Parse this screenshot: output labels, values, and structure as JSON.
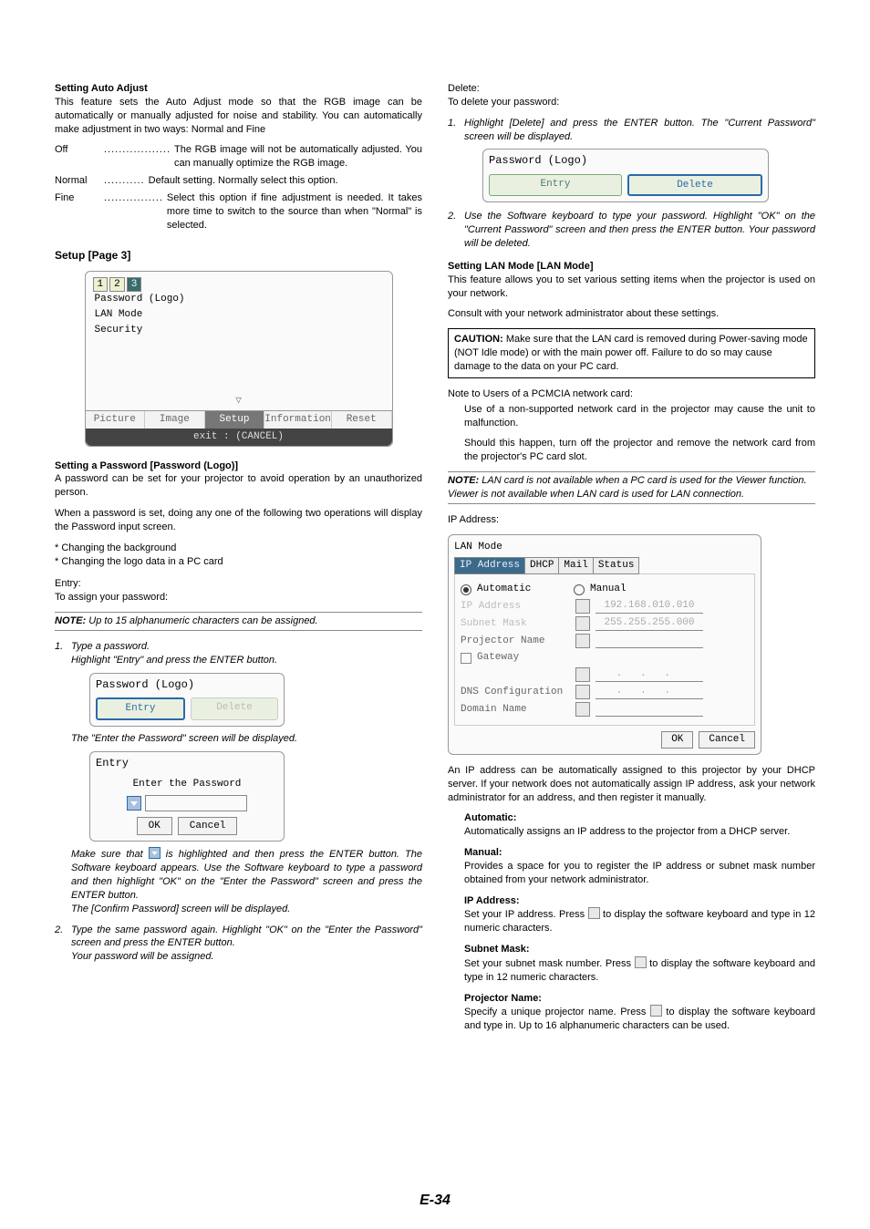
{
  "left": {
    "h1": "Setting Auto Adjust",
    "p1": "This feature sets the Auto Adjust mode so that the RGB image can be automatically or manually adjusted for noise and stability. You can automatically make adjustment in two ways: Normal and Fine",
    "def_off_l": "Off",
    "def_off_d": "..................",
    "def_off_t": "The RGB image will not be automatically adjusted. You can manually optimize the RGB image.",
    "def_norm_l": "Normal",
    "def_norm_d": "...........",
    "def_norm_t": "Default setting. Normally select this option.",
    "def_fine_l": "Fine",
    "def_fine_d": "................",
    "def_fine_t": "Select this option if fine adjustment is needed. It takes more time to switch to the source than when \"Normal\" is selected.",
    "h2": "Setup [Page 3]",
    "osd": {
      "tabs": [
        "1",
        "2",
        "3"
      ],
      "items": [
        "Password (Logo)",
        "LAN Mode",
        "Security"
      ],
      "menu": [
        "Picture",
        "Image",
        "Setup",
        "Information",
        "Reset"
      ],
      "exit": "exit : (CANCEL)"
    },
    "h3": "Setting a Password [Password (Logo)]",
    "p3a": "A password can be set for your projector to avoid operation by an unauthorized person.",
    "p3b": "When a password is set, doing any one of the following two operations will display the Password input screen.",
    "b1": "* Changing the background",
    "b2": "* Changing the logo data in a PC card",
    "entry_l": "Entry:",
    "entry_t": "To assign your password:",
    "note1_b": "NOTE:",
    "note1_t": " Up to 15 alphanumeric characters can be assigned.",
    "s1n": "1.",
    "s1a": "Type a password.",
    "s1b": "Highlight \"Entry\" and press the ENTER button.",
    "dlg1_title": "Password (Logo)",
    "dlg1_entry": "Entry",
    "dlg1_delete": "Delete",
    "s1c": "The \"Enter the Password\" screen will be displayed.",
    "dlg2_title": "Entry",
    "dlg2_sub": "Enter the Password",
    "dlg2_ok": "OK",
    "dlg2_cancel": "Cancel",
    "s1d": "Make sure that ",
    "s1d2": " is highlighted and then press the ENTER button. The Software keyboard appears. Use the Software keyboard to type a password and then highlight \"OK\" on the \"Enter the Password\" screen and press the ENTER button.",
    "s1e": "The [Confirm Password] screen will be displayed.",
    "s2n": "2.",
    "s2a": "Type the same password again. Highlight \"OK\" on the \"Enter the Password\" screen and press the ENTER button.",
    "s2b": "Your password will be assigned."
  },
  "right": {
    "del_l": "Delete:",
    "del_t": "To delete your password:",
    "d1n": "1.",
    "d1": "Highlight [Delete] and press the ENTER button. The \"Current Password\" screen will be displayed.",
    "dlgD_title": "Password (Logo)",
    "dlgD_entry": "Entry",
    "dlgD_delete": "Delete",
    "d2n": "2.",
    "d2": "Use the Software keyboard to type your password. Highlight \"OK\" on the \"Current Password\" screen and then press the ENTER button. Your password will be deleted.",
    "h_lan": "Setting LAN Mode [LAN Mode]",
    "lan_p1": "This feature allows you to set various setting items when the projector is used on your network.",
    "lan_p2": "Consult with your network administrator about these settings.",
    "caution_b": "CAUTION:",
    "caution_t": " Make sure that the LAN card is removed during Power-saving mode (NOT Idle mode) or with the main power off. Failure to do so may cause damage to the data on your PC card.",
    "pcm_h": "Note to Users of a PCMCIA network card:",
    "pcm_1": "Use of a non-supported network card in the projector may cause the unit to malfunction.",
    "pcm_2": "Should this happen, turn off the projector and remove the network card from the projector's PC card slot.",
    "note2_b": "NOTE:",
    "note2_t": " LAN card is not available when a PC card is used for the Viewer function. Viewer is not available when LAN card is used for LAN connection.",
    "ip_h": "IP Address:",
    "lan_dlg": {
      "title": "LAN Mode",
      "tabs": [
        "IP Address",
        "DHCP",
        "Mail",
        "Status"
      ],
      "auto": "Automatic",
      "manual": "Manual",
      "rows": {
        "ip_l": "IP Address",
        "ip_v": "192.168.010.010",
        "sm_l": "Subnet Mask",
        "sm_v": "255.255.255.000",
        "pn_l": "Projector Name",
        "gw_l": "Gateway",
        "dns_l": "DNS Configuration",
        "dn_l": "Domain Name"
      },
      "ok": "OK",
      "cancel": "Cancel"
    },
    "ip_p": "An IP address can be automatically assigned to this projector by your DHCP server. If your network does not automatically assign IP address, ask your network administrator for an address, and then register it manually.",
    "auto_h": "Automatic:",
    "auto_t": "Automatically assigns an IP address to the projector from a DHCP server.",
    "man_h": "Manual:",
    "man_t": "Provides a space for you to register the IP address or subnet mask number obtained from your network administrator.",
    "ipa_h": "IP Address:",
    "ipa_t1": "Set your IP address. Press ",
    "ipa_t2": " to display the software keyboard and type in 12 numeric characters.",
    "sm_h": "Subnet Mask:",
    "sm_t1": "Set your subnet mask number. Press ",
    "sm_t2": " to display the software keyboard and type in 12 numeric characters.",
    "pn_h": "Projector Name:",
    "pn_t1": "Specify a unique projector name. Press ",
    "pn_t2": " to display the software keyboard and type in. Up to 16 alphanumeric characters can be used."
  },
  "page_num": "E-34"
}
